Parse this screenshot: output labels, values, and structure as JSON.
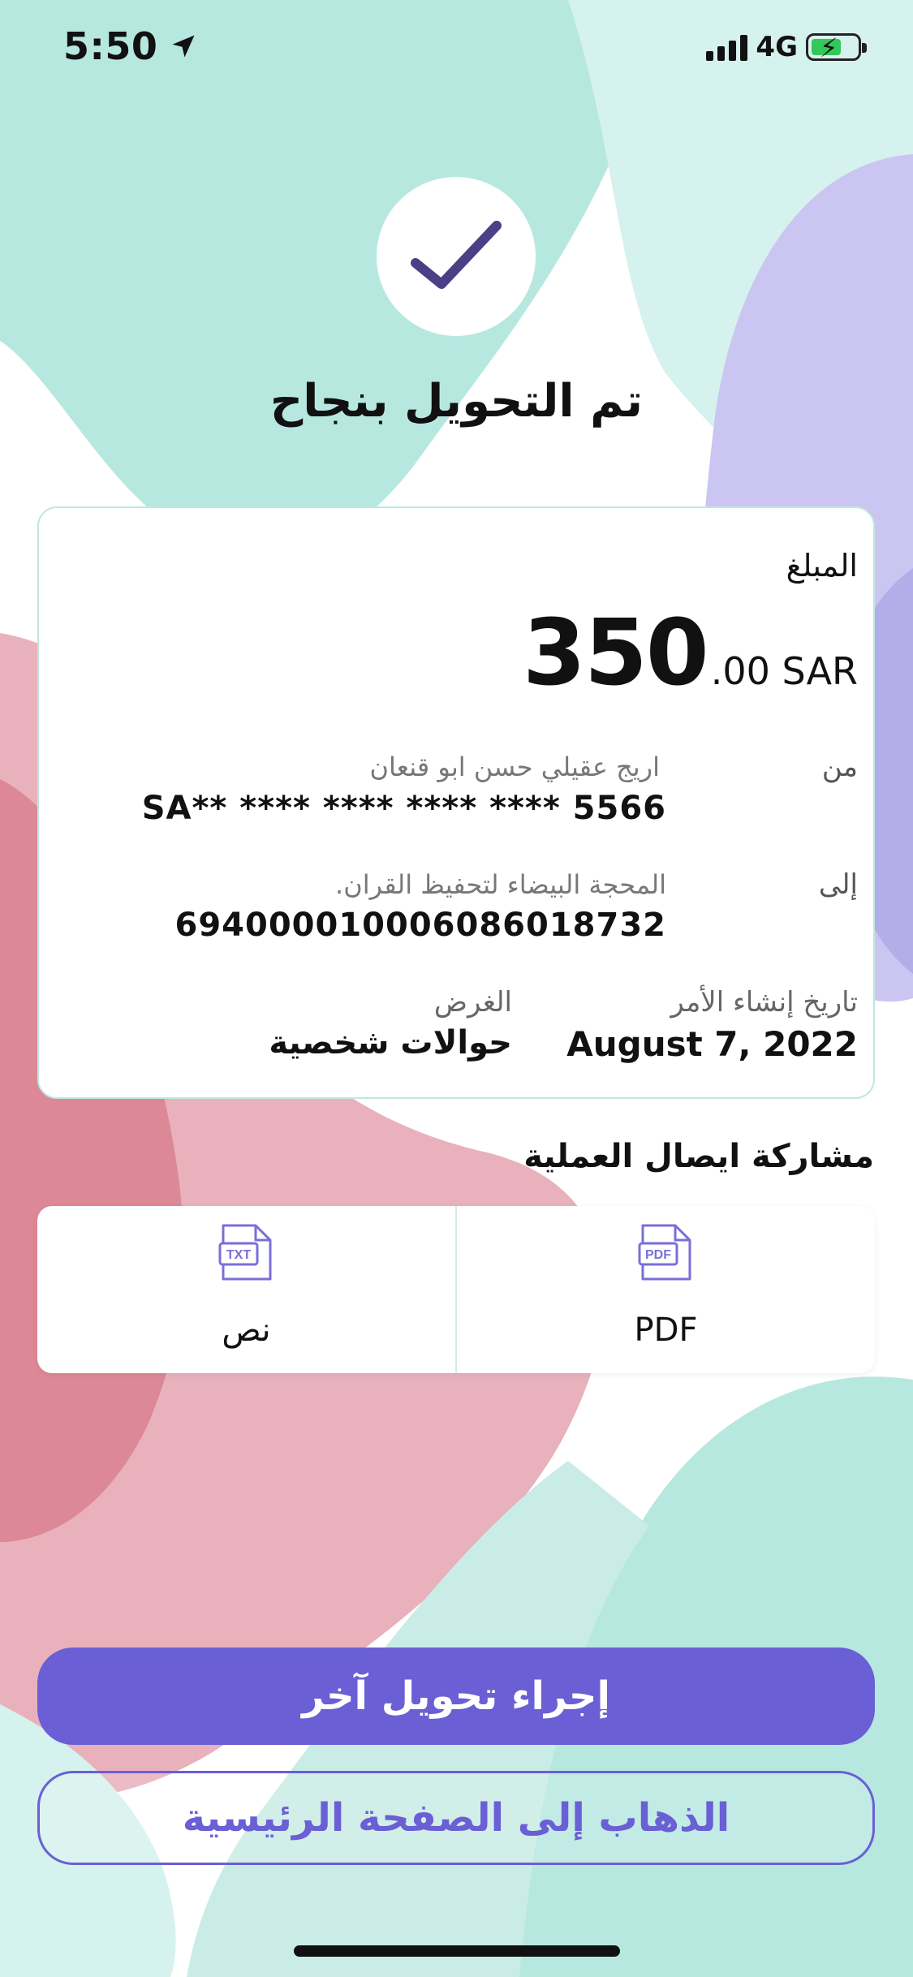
{
  "status_bar": {
    "time": "5:50",
    "network": "4G"
  },
  "success": {
    "title": "تم التحويل بنجاح"
  },
  "receipt": {
    "amount_label": "المبلغ",
    "amount_integer": "350",
    "amount_suffix": ".00 SAR",
    "from_label": "من",
    "from_name": "اريج عقيلي حسن ابو قنعان",
    "from_account": "SA** **** **** **** **** 5566",
    "to_label": "إلى",
    "to_name": "المحجة البيضاء لتحفيظ القران.",
    "to_account": "69400001000608601873​2",
    "date_label": "تاريخ إنشاء الأمر",
    "date_value": "August 7, 2022",
    "purpose_label": "الغرض",
    "purpose_value": "حوالات شخصية"
  },
  "share": {
    "title": "مشاركة ايصال العملية",
    "options": [
      {
        "label": "PDF",
        "icon": "pdf-file-icon",
        "icon_text": "PDF"
      },
      {
        "label": "نص",
        "icon": "txt-file-icon",
        "icon_text": "TXT"
      }
    ]
  },
  "actions": {
    "primary_label": "إجراء تحويل آخر",
    "secondary_label": "الذهاب إلى الصفحة الرئيسية"
  },
  "colors": {
    "accent": "#6a5fd4",
    "teal_bg": "#b7e8e0",
    "lavender_bg": "#c9c5f0",
    "pink_bg": "#e4a9b4"
  }
}
